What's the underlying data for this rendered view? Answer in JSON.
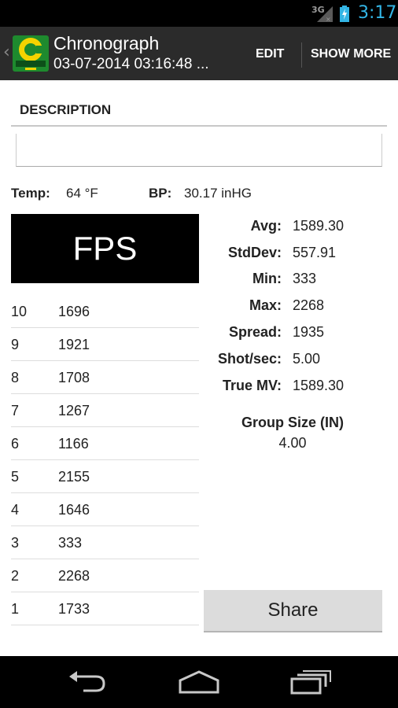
{
  "status_bar": {
    "network": "3G",
    "time": "3:17",
    "accent_color": "#33b5e5"
  },
  "action_bar": {
    "title": "Chronograph",
    "subtitle": "03-07-2014 03:16:48 ...",
    "icon": "chronograph-app-icon",
    "edit_label": "EDIT",
    "show_more_label": "SHOW MORE"
  },
  "description": {
    "header": "DESCRIPTION",
    "value": ""
  },
  "conditions": {
    "temp_label": "Temp:",
    "temp_value": "64 °F",
    "bp_label": "BP:",
    "bp_value": "30.17 inHG"
  },
  "fps_header": "FPS",
  "shots": [
    {
      "num": "10",
      "velocity": "1696"
    },
    {
      "num": "9",
      "velocity": "1921"
    },
    {
      "num": "8",
      "velocity": "1708"
    },
    {
      "num": "7",
      "velocity": "1267"
    },
    {
      "num": "6",
      "velocity": "1166"
    },
    {
      "num": "5",
      "velocity": "2155"
    },
    {
      "num": "4",
      "velocity": "1646"
    },
    {
      "num": "3",
      "velocity": "333"
    },
    {
      "num": "2",
      "velocity": "2268"
    },
    {
      "num": "1",
      "velocity": "1733"
    }
  ],
  "stats": [
    {
      "label": "Avg:",
      "value": "1589.30"
    },
    {
      "label": "StdDev:",
      "value": "557.91"
    },
    {
      "label": "Min:",
      "value": "333"
    },
    {
      "label": "Max:",
      "value": "2268"
    },
    {
      "label": "Spread:",
      "value": "1935"
    },
    {
      "label": "Shot/sec:",
      "value": "5.00"
    },
    {
      "label": "True MV:",
      "value": "1589.30"
    }
  ],
  "group": {
    "label": "Group Size (IN)",
    "value": "4.00"
  },
  "share_label": "Share",
  "nav_bar": {
    "back_icon": "back-icon",
    "home_icon": "home-icon",
    "recents_icon": "recents-icon"
  }
}
